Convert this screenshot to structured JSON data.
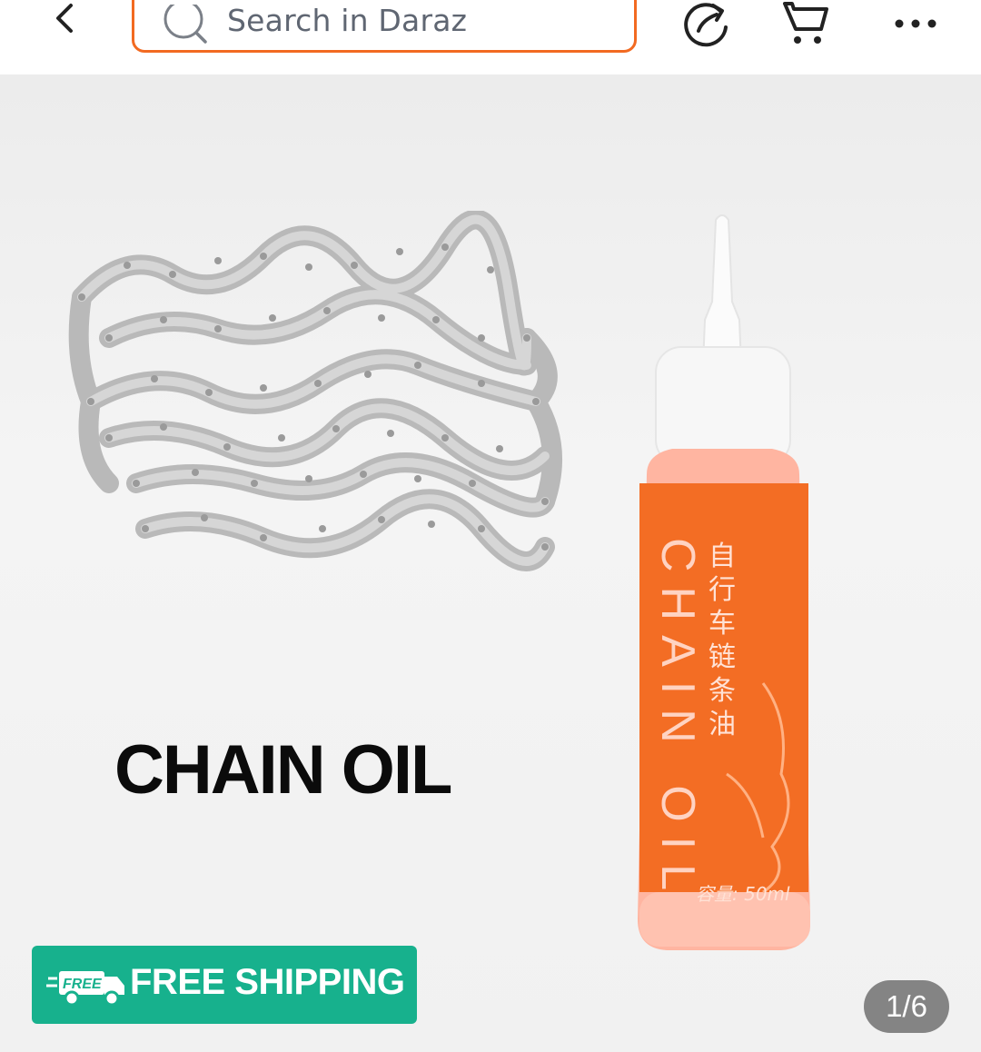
{
  "header": {
    "search": {
      "placeholder": "Search in Daraz"
    },
    "icons": {
      "back": "chevron-left-icon",
      "share": "share-icon",
      "cart": "cart-icon",
      "more": "more-dots-icon"
    }
  },
  "product_image": {
    "headline": "CHAIN OIL",
    "bottle_label_text": "CHAIN OIL",
    "bottle_label_cn": "自行车链条油",
    "bottle_capacity": "容量: 50ml"
  },
  "badge": {
    "label": "FREE SHIPPING",
    "icon_text": "FREE"
  },
  "gallery": {
    "counter": "1/6"
  },
  "colors": {
    "accent": "#f26a21",
    "badge": "#17b18d",
    "bottle": "#f26a21"
  }
}
